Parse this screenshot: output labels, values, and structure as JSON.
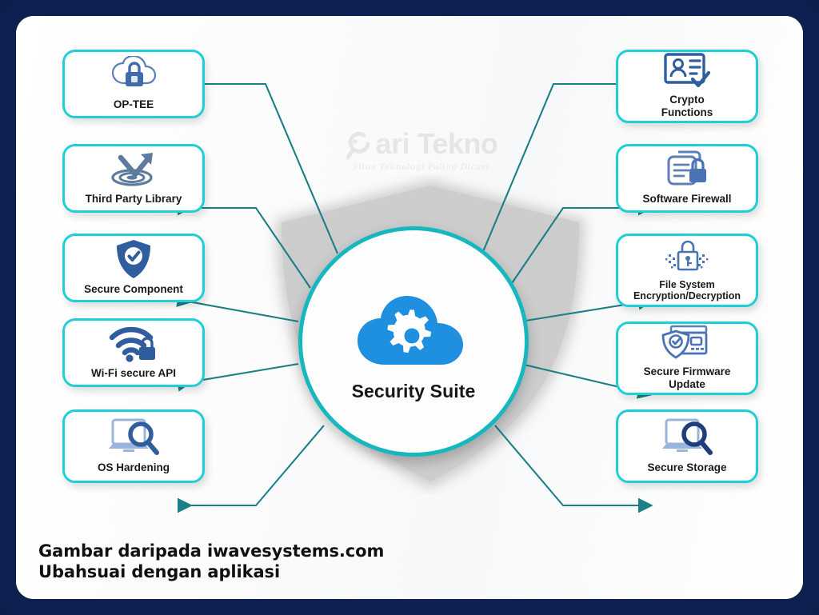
{
  "frame": {
    "border_color": "#0e2050",
    "canvas_color": "#ffffff"
  },
  "watermark": {
    "title": "ari Tekno",
    "initial": "C",
    "tagline": "Situs Teknologi Paling Dicari"
  },
  "center": {
    "label": "Security Suite",
    "icon": "cloud-gear-icon",
    "icon_color": "#1f8fe0",
    "ring_color": "#17b8bd"
  },
  "shield": {
    "fill": "#cfcfcf",
    "name": "shield-backdrop"
  },
  "colors": {
    "card_border": "#1fcfd6",
    "connector": "#1a7f86",
    "icon_blue": "#2f5d9e",
    "icon_light_blue": "#9ab4dc",
    "accent_blue": "#1f8fe0",
    "text": "#1a1a1c"
  },
  "left_cards": [
    {
      "label": "OP-TEE",
      "icon": "cloud-lock-icon"
    },
    {
      "label": "Third Party Library",
      "icon": "target-arrow-icon"
    },
    {
      "label": "Secure Component",
      "icon": "shield-check-icon"
    },
    {
      "label": "Wi-Fi secure API",
      "icon": "wifi-lock-icon"
    },
    {
      "label": "OS Hardening",
      "icon": "laptop-magnifier-icon"
    }
  ],
  "right_cards": [
    {
      "label": "Crypto\nFunctions",
      "icon": "id-card-check-icon"
    },
    {
      "label": "Software Firewall",
      "icon": "document-lock-icon"
    },
    {
      "label": "File System\nEncryption/Decryption",
      "icon": "pixel-lock-icon"
    },
    {
      "label": "Secure Firmware\nUpdate",
      "icon": "shield-card-icon"
    },
    {
      "label": "Secure Storage",
      "icon": "laptop-magnifier-icon"
    }
  ],
  "caption": {
    "line1": "Gambar daripada iwavesystems.com",
    "line2": "Ubahsuai dengan aplikasi"
  }
}
